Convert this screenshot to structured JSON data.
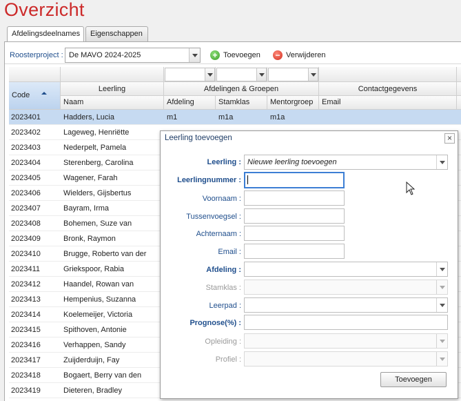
{
  "page": {
    "title": "Overzicht"
  },
  "tabs": [
    {
      "label": "Afdelingsdeelnames",
      "active": true
    },
    {
      "label": "Eigenschappen",
      "active": false
    }
  ],
  "toolbar": {
    "project_label": "Roosterproject :",
    "project_value": "De MAVO 2024-2025",
    "add_label": "Toevoegen",
    "remove_label": "Verwijderen",
    "add_icon": "plus-circle-icon",
    "remove_icon": "minus-circle-icon"
  },
  "table": {
    "group_headers": {
      "leerling": "Leerling",
      "afdelingen": "Afdelingen & Groepen",
      "contact": "Contactgegevens"
    },
    "columns": {
      "code": "Code",
      "naam": "Naam",
      "afdeling": "Afdeling",
      "stamklas": "Stamklas",
      "mentorgroep": "Mentorgroep",
      "email": "Email"
    },
    "rows": [
      {
        "code": "2023401",
        "naam": "Hadders, Lucia",
        "afdeling": "m1",
        "stamklas": "m1a",
        "mentorgroep": "m1a"
      },
      {
        "code": "2023402",
        "naam": "Lageweg, Henriëtte"
      },
      {
        "code": "2023403",
        "naam": "Nederpelt, Pamela"
      },
      {
        "code": "2023404",
        "naam": "Sterenberg, Carolina"
      },
      {
        "code": "2023405",
        "naam": "Wagener, Farah"
      },
      {
        "code": "2023406",
        "naam": "Wielders, Gijsbertus"
      },
      {
        "code": "2023407",
        "naam": "Bayram, Irma"
      },
      {
        "code": "2023408",
        "naam": "Bohemen, Suze van"
      },
      {
        "code": "2023409",
        "naam": "Bronk, Raymon"
      },
      {
        "code": "2023410",
        "naam": "Brugge, Roberto van der"
      },
      {
        "code": "2023411",
        "naam": "Griekspoor, Rabia"
      },
      {
        "code": "2023412",
        "naam": "Haandel, Rowan van"
      },
      {
        "code": "2023413",
        "naam": "Hempenius, Suzanna"
      },
      {
        "code": "2023414",
        "naam": "Koelemeijer, Victoria"
      },
      {
        "code": "2023415",
        "naam": "Spithoven, Antonie"
      },
      {
        "code": "2023416",
        "naam": "Verhappen, Sandy"
      },
      {
        "code": "2023417",
        "naam": "Zuijderduijn, Fay"
      },
      {
        "code": "2023418",
        "naam": "Bogaert, Berry van den"
      },
      {
        "code": "2023419",
        "naam": "Dieteren, Bradley"
      }
    ]
  },
  "dialog": {
    "title": "Leerling toevoegen",
    "fields": {
      "leerling": {
        "label": "Leerling :",
        "value": "Nieuwe leerling toevoegen"
      },
      "leerlingnummer": {
        "label": "Leerlingnummer :",
        "value": ""
      },
      "voornaam": {
        "label": "Voornaam :",
        "value": ""
      },
      "tussenvoegsel": {
        "label": "Tussenvoegsel :",
        "value": ""
      },
      "achternaam": {
        "label": "Achternaam :",
        "value": ""
      },
      "email": {
        "label": "Email :",
        "value": ""
      },
      "afdeling": {
        "label": "Afdeling :",
        "value": ""
      },
      "stamklas": {
        "label": "Stamklas :",
        "value": ""
      },
      "leerpad": {
        "label": "Leerpad :",
        "value": ""
      },
      "prognose": {
        "label": "Prognose(%) :",
        "value": ""
      },
      "opleiding": {
        "label": "Opleiding :",
        "value": ""
      },
      "profiel": {
        "label": "Profiel :",
        "value": ""
      }
    },
    "submit_label": "Toevoegen"
  },
  "colors": {
    "title": "#cc2a2a",
    "label_blue": "#1f4e8c",
    "selected_row": "#c6daf1"
  }
}
